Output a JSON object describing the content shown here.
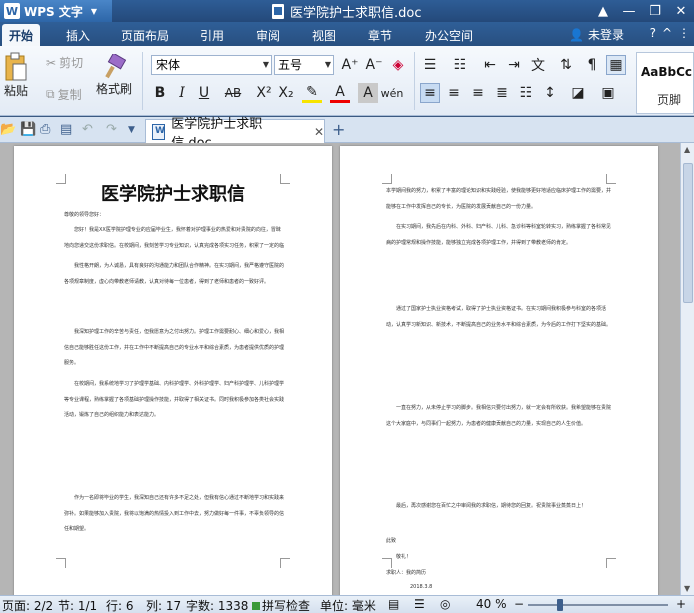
{
  "app": {
    "name": "WPS 文字",
    "doc_title": "医学院护士求职信.doc"
  },
  "tabs": [
    "开始",
    "插入",
    "页面布局",
    "引用",
    "审阅",
    "视图",
    "章节",
    "办公空间"
  ],
  "login_label": "未登录",
  "ribbon": {
    "paste": "粘贴",
    "cut": "剪切",
    "copy": "复制",
    "format_painter": "格式刷",
    "font": "宋体",
    "size": "五号",
    "style_sample": "AaBbCc",
    "style_label": "页脚"
  },
  "doc_tab": {
    "label": "医学院护士求职信.doc"
  },
  "page_left": {
    "title": "医学院护士求职信",
    "paragraphs": [
      "尊敬的领导您好：",
      "您好！我是XX医学院护理专业的应届毕业生，我怀着对护理事业的热爱和对贵院的向往，冒昧地向您递交这份求职信。在校期间，我刻苦学习专业知识，认真完成各项实习任务，积累了一定的临床护理经验。",
      "我性格开朗，为人诚恳，具有良好的沟通能力和团队合作精神。在实习期间，我严格遵守医院的各项规章制度，虚心向带教老师请教，认真对待每一位患者，得到了老师和患者的一致好评。",
      "我深知护理工作的辛苦与责任，但我愿意为之付出努力。护理工作需要耐心、细心和爱心，我相信自己能够胜任这份工作，并在工作中不断提高自己的专业水平和综合素质，为患者提供优质的护理服务。",
      "在校期间，我系统地学习了护理学基础、内科护理学、外科护理学、妇产科护理学、儿科护理学等专业课程，熟练掌握了各项基础护理操作技能，并取得了相关证书。同时我积极参加各类社会实践活动，锻炼了自己的组织能力和表达能力。",
      "作为一名即将毕业的学生，我深知自己还有许多不足之处，但我有信心通过不断地学习和实践来弥补。如果能够加入贵院，我将以饱满的热情投入到工作中去，努力做好每一件事，不辜负领导的信任和期望。"
    ]
  },
  "page_right": {
    "paragraphs": [
      "本学期间我的努力，积累了丰富的理论知识和实践经验，使我能够更好地适应临床护理工作的需要，并能够在工作中发挥自己的专长，为医院的发展贡献自己的一份力量。",
      "在实习期间，我先后在内科、外科、妇产科、儿科、急诊科等科室轮转实习，熟练掌握了各科常见病的护理常规和操作技能，能够独立完成各项护理工作，并得到了带教老师的肯定。",
      "通过了国家护士执业资格考试，取得了护士执业资格证书。在实习期间我积极参与科室的各项活动，认真学习新知识、新技术，不断提高自己的业务水平和综合素质，为今后的工作打下坚实的基础。",
      "一直在努力，从未停止学习的脚步。我相信只要付出努力，就一定会有所收获。我希望能够在贵院这个大家庭中，与同事们一起努力，为患者的健康贡献自己的力量，实现自己的人生价值。",
      "最后，再次感谢您在百忙之中审阅我的求职信，期待您的回复。祝贵院事业蒸蒸日上！"
    ],
    "closing": "此致",
    "salute": "敬礼！",
    "signature": "求职人：我的简历",
    "date": "2018.3.8"
  },
  "status": {
    "page": "页面: 2/2",
    "section": "节: 1/1",
    "row": "行: 6",
    "col": "列: 17",
    "words": "字数: 1338",
    "spell": "拼写检查",
    "unit": "单位: 毫米",
    "zoom": "40 %",
    "zoom_level": 0.22
  }
}
